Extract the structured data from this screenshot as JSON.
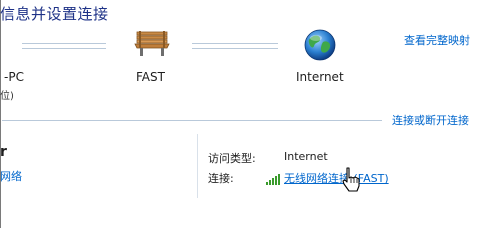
{
  "header": {
    "title": "信息并设置连接",
    "full_map_link": "查看完整映射"
  },
  "network_map": {
    "computer": {
      "name": "-PC",
      "sub": "位)",
      "icon": "computer-icon"
    },
    "router": {
      "name": "FAST",
      "icon": "bench-icon"
    },
    "internet": {
      "name": "Internet",
      "icon": "globe-icon"
    }
  },
  "connect_disconnect_link": "连接或断开连接",
  "active_network": {
    "name_fragment": "r",
    "type_fragment": "网络",
    "access_type_label": "访问类型:",
    "access_type_value": "Internet",
    "connection_label": "连接:",
    "connection_value": "无线网络连接 (FAST)",
    "signal_icon": "signal-bars-icon"
  },
  "colors": {
    "title": "#1e3287",
    "link": "#0066cc",
    "rule": "#b9c9da"
  }
}
